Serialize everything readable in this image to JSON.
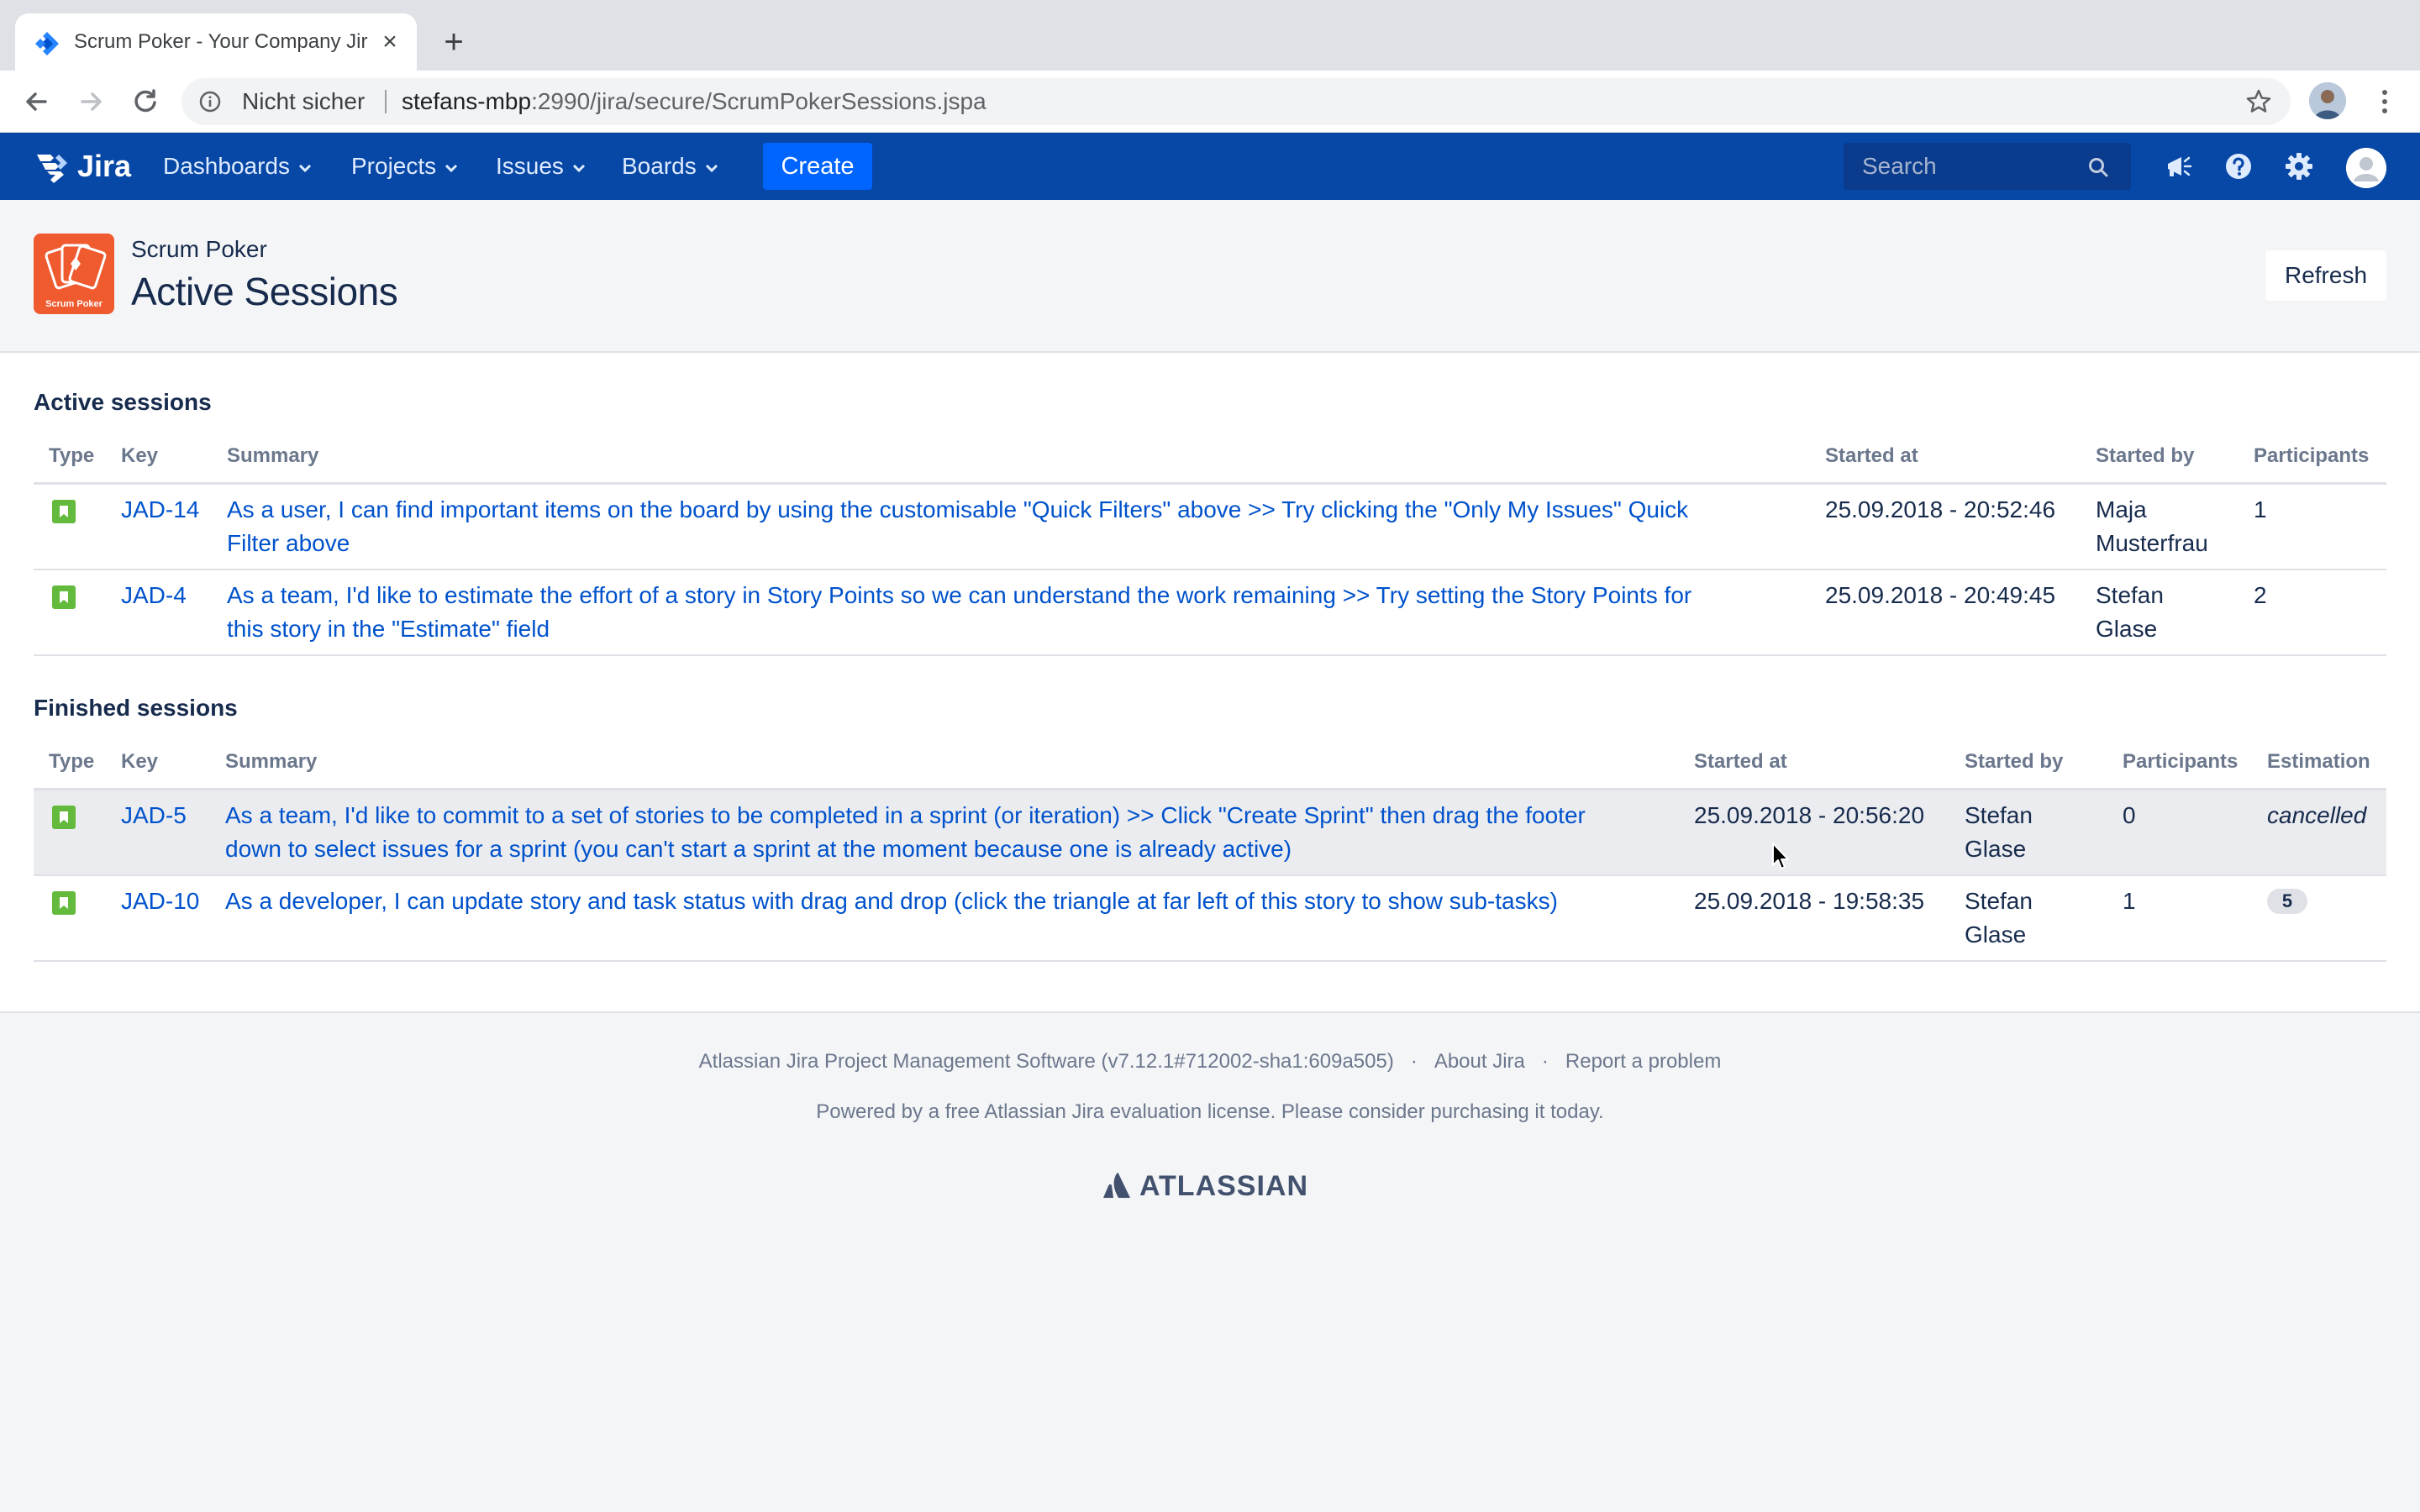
{
  "browser": {
    "tab_title": "Scrum Poker - Your Company Jira",
    "security_label": "Nicht sicher",
    "url_host": "stefans-mbp",
    "url_path": ":2990/jira/secure/ScrumPokerSessions.jspa"
  },
  "jira_nav": {
    "product": "Jira",
    "menus": [
      "Dashboards",
      "Projects",
      "Issues",
      "Boards"
    ],
    "create_label": "Create",
    "search_placeholder": "Search"
  },
  "page": {
    "app_name": "Scrum Poker",
    "title": "Active Sessions",
    "refresh_label": "Refresh",
    "logo_text": "Scrum Poker"
  },
  "active_sessions": {
    "title": "Active sessions",
    "columns": [
      "Type",
      "Key",
      "Summary",
      "Started at",
      "Started by",
      "Participants"
    ],
    "rows": [
      {
        "type": "story",
        "key": "JAD-14",
        "summary_line1": "As a user, I can find important items on the board by using the customisable \"Quick Filters\" above >> Try clicking the \"Only My Issues\" Quick",
        "summary_line2": "Filter above",
        "started_at": "25.09.2018 - 20:52:46",
        "started_by_line1": "Maja",
        "started_by_line2": "Musterfrau",
        "participants": "1"
      },
      {
        "type": "story",
        "key": "JAD-4",
        "summary_line1": "As a team, I'd like to estimate the effort of a story in Story Points so we can understand the work remaining >> Try setting the Story Points for",
        "summary_line2": "this story in the \"Estimate\" field",
        "started_at": "25.09.2018 - 20:49:45",
        "started_by_line1": "Stefan",
        "started_by_line2": "Glase",
        "participants": "2"
      }
    ]
  },
  "finished_sessions": {
    "title": "Finished sessions",
    "columns": [
      "Type",
      "Key",
      "Summary",
      "Started at",
      "Started by",
      "Participants",
      "Estimation"
    ],
    "rows": [
      {
        "type": "story",
        "key": "JAD-5",
        "summary_line1": "As a team, I'd like to commit to a set of stories to be completed in a sprint (or iteration) >> Click \"Create Sprint\" then drag the footer",
        "summary_line2": "down to select issues for a sprint (you can't start a sprint at the moment because one is already active)",
        "started_at": "25.09.2018 - 20:56:20",
        "started_by_line1": "Stefan",
        "started_by_line2": "Glase",
        "participants": "0",
        "estimation": "cancelled"
      },
      {
        "type": "story",
        "key": "JAD-10",
        "summary_line1": "As a developer, I can update story and task status with drag and drop (click the triangle at far left of this story to show sub-tasks)",
        "summary_line2": "",
        "started_at": "25.09.2018 - 19:58:35",
        "started_by_line1": "Stefan",
        "started_by_line2": "Glase",
        "participants": "1",
        "estimation": "5"
      }
    ]
  },
  "footer": {
    "software": "Atlassian Jira Project Management Software (v7.12.1#712002-sha1:609a505)",
    "about": "About Jira",
    "report": "Report a problem",
    "license": "Powered by a free Atlassian Jira evaluation license. Please consider purchasing it today.",
    "brand": "ATLASSIAN"
  },
  "colors": {
    "jira_nav": "#0747a6",
    "create_button": "#0065ff",
    "link": "#0052cc",
    "story_icon": "#63ba3c",
    "app_logo": "#ef5a2f"
  }
}
